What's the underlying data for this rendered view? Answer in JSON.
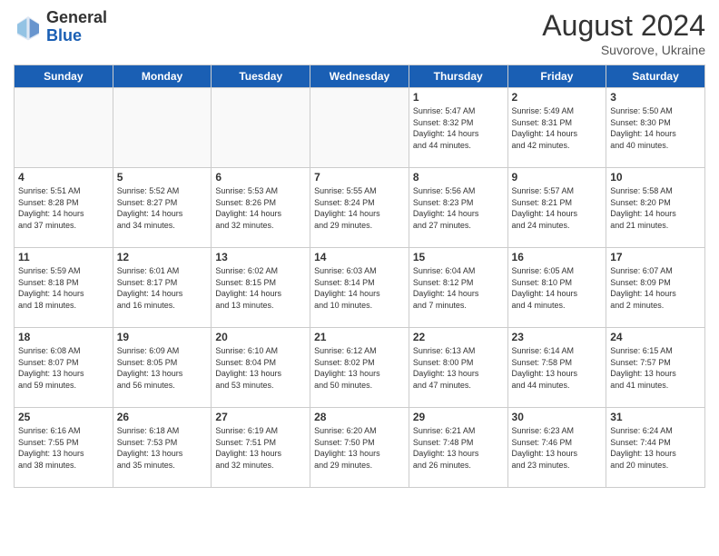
{
  "header": {
    "logo_general": "General",
    "logo_blue": "Blue",
    "month_year": "August 2024",
    "location": "Suvorove, Ukraine"
  },
  "weekdays": [
    "Sunday",
    "Monday",
    "Tuesday",
    "Wednesday",
    "Thursday",
    "Friday",
    "Saturday"
  ],
  "weeks": [
    [
      {
        "day": "",
        "info": ""
      },
      {
        "day": "",
        "info": ""
      },
      {
        "day": "",
        "info": ""
      },
      {
        "day": "",
        "info": ""
      },
      {
        "day": "1",
        "info": "Sunrise: 5:47 AM\nSunset: 8:32 PM\nDaylight: 14 hours\nand 44 minutes."
      },
      {
        "day": "2",
        "info": "Sunrise: 5:49 AM\nSunset: 8:31 PM\nDaylight: 14 hours\nand 42 minutes."
      },
      {
        "day": "3",
        "info": "Sunrise: 5:50 AM\nSunset: 8:30 PM\nDaylight: 14 hours\nand 40 minutes."
      }
    ],
    [
      {
        "day": "4",
        "info": "Sunrise: 5:51 AM\nSunset: 8:28 PM\nDaylight: 14 hours\nand 37 minutes."
      },
      {
        "day": "5",
        "info": "Sunrise: 5:52 AM\nSunset: 8:27 PM\nDaylight: 14 hours\nand 34 minutes."
      },
      {
        "day": "6",
        "info": "Sunrise: 5:53 AM\nSunset: 8:26 PM\nDaylight: 14 hours\nand 32 minutes."
      },
      {
        "day": "7",
        "info": "Sunrise: 5:55 AM\nSunset: 8:24 PM\nDaylight: 14 hours\nand 29 minutes."
      },
      {
        "day": "8",
        "info": "Sunrise: 5:56 AM\nSunset: 8:23 PM\nDaylight: 14 hours\nand 27 minutes."
      },
      {
        "day": "9",
        "info": "Sunrise: 5:57 AM\nSunset: 8:21 PM\nDaylight: 14 hours\nand 24 minutes."
      },
      {
        "day": "10",
        "info": "Sunrise: 5:58 AM\nSunset: 8:20 PM\nDaylight: 14 hours\nand 21 minutes."
      }
    ],
    [
      {
        "day": "11",
        "info": "Sunrise: 5:59 AM\nSunset: 8:18 PM\nDaylight: 14 hours\nand 18 minutes."
      },
      {
        "day": "12",
        "info": "Sunrise: 6:01 AM\nSunset: 8:17 PM\nDaylight: 14 hours\nand 16 minutes."
      },
      {
        "day": "13",
        "info": "Sunrise: 6:02 AM\nSunset: 8:15 PM\nDaylight: 14 hours\nand 13 minutes."
      },
      {
        "day": "14",
        "info": "Sunrise: 6:03 AM\nSunset: 8:14 PM\nDaylight: 14 hours\nand 10 minutes."
      },
      {
        "day": "15",
        "info": "Sunrise: 6:04 AM\nSunset: 8:12 PM\nDaylight: 14 hours\nand 7 minutes."
      },
      {
        "day": "16",
        "info": "Sunrise: 6:05 AM\nSunset: 8:10 PM\nDaylight: 14 hours\nand 4 minutes."
      },
      {
        "day": "17",
        "info": "Sunrise: 6:07 AM\nSunset: 8:09 PM\nDaylight: 14 hours\nand 2 minutes."
      }
    ],
    [
      {
        "day": "18",
        "info": "Sunrise: 6:08 AM\nSunset: 8:07 PM\nDaylight: 13 hours\nand 59 minutes."
      },
      {
        "day": "19",
        "info": "Sunrise: 6:09 AM\nSunset: 8:05 PM\nDaylight: 13 hours\nand 56 minutes."
      },
      {
        "day": "20",
        "info": "Sunrise: 6:10 AM\nSunset: 8:04 PM\nDaylight: 13 hours\nand 53 minutes."
      },
      {
        "day": "21",
        "info": "Sunrise: 6:12 AM\nSunset: 8:02 PM\nDaylight: 13 hours\nand 50 minutes."
      },
      {
        "day": "22",
        "info": "Sunrise: 6:13 AM\nSunset: 8:00 PM\nDaylight: 13 hours\nand 47 minutes."
      },
      {
        "day": "23",
        "info": "Sunrise: 6:14 AM\nSunset: 7:58 PM\nDaylight: 13 hours\nand 44 minutes."
      },
      {
        "day": "24",
        "info": "Sunrise: 6:15 AM\nSunset: 7:57 PM\nDaylight: 13 hours\nand 41 minutes."
      }
    ],
    [
      {
        "day": "25",
        "info": "Sunrise: 6:16 AM\nSunset: 7:55 PM\nDaylight: 13 hours\nand 38 minutes."
      },
      {
        "day": "26",
        "info": "Sunrise: 6:18 AM\nSunset: 7:53 PM\nDaylight: 13 hours\nand 35 minutes."
      },
      {
        "day": "27",
        "info": "Sunrise: 6:19 AM\nSunset: 7:51 PM\nDaylight: 13 hours\nand 32 minutes."
      },
      {
        "day": "28",
        "info": "Sunrise: 6:20 AM\nSunset: 7:50 PM\nDaylight: 13 hours\nand 29 minutes."
      },
      {
        "day": "29",
        "info": "Sunrise: 6:21 AM\nSunset: 7:48 PM\nDaylight: 13 hours\nand 26 minutes."
      },
      {
        "day": "30",
        "info": "Sunrise: 6:23 AM\nSunset: 7:46 PM\nDaylight: 13 hours\nand 23 minutes."
      },
      {
        "day": "31",
        "info": "Sunrise: 6:24 AM\nSunset: 7:44 PM\nDaylight: 13 hours\nand 20 minutes."
      }
    ]
  ]
}
